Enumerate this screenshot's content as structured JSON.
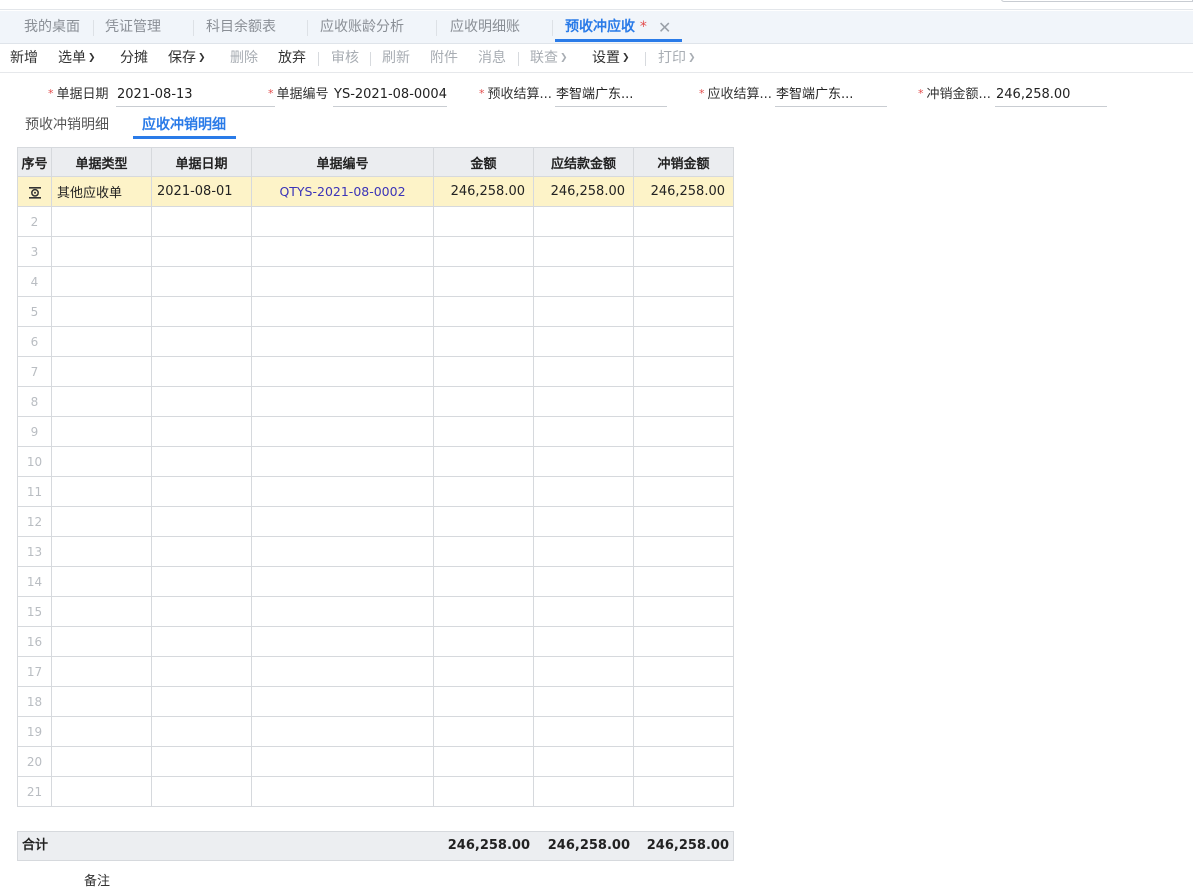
{
  "tabs": [
    {
      "label": "我的桌面"
    },
    {
      "label": "凭证管理"
    },
    {
      "label": "科目余额表"
    },
    {
      "label": "应收账龄分析"
    },
    {
      "label": "应收明细账"
    },
    {
      "label": "预收冲应收",
      "modified_mark": "*",
      "close": "✕"
    }
  ],
  "toolbar": {
    "add": "新增",
    "select": "选单",
    "allocate": "分摊",
    "save": "保存",
    "delete": "删除",
    "discard": "放弃",
    "audit": "审核",
    "refresh": "刷新",
    "attachment": "附件",
    "message": "消息",
    "linked_query": "联查",
    "settings": "设置",
    "print": "打印"
  },
  "form": {
    "doc_date_label": "单据日期",
    "doc_date_value": "2021-08-13",
    "doc_no_label": "单据编号",
    "doc_no_value": "YS-2021-08-0004",
    "prepay_settle_label": "预收结算...",
    "prepay_settle_value": "李智端广东...",
    "ar_settle_label": "应收结算...",
    "ar_settle_value": "李智端广东...",
    "writeoff_amount_label": "冲销金额...",
    "writeoff_amount_value": "246,258.00"
  },
  "subtabs": {
    "prepay_detail": "预收冲销明细",
    "ar_detail": "应收冲销明细"
  },
  "grid": {
    "columns": [
      "序号",
      "单据类型",
      "单据日期",
      "单据编号",
      "金额",
      "应结款金额",
      "冲销金额"
    ],
    "rows": [
      {
        "type": "其他应收单",
        "date": "2021-08-01",
        "doc_no": "QTYS-2021-08-0002",
        "amount": "246,258.00",
        "due": "246,258.00",
        "writeoff": "246,258.00"
      }
    ],
    "row_numbers": [
      "2",
      "3",
      "4",
      "5",
      "6",
      "7",
      "8",
      "9",
      "10",
      "11",
      "12",
      "13",
      "14",
      "15",
      "16",
      "17",
      "18",
      "19",
      "20",
      "21"
    ]
  },
  "totals": {
    "label": "合计",
    "amount": "246,258.00",
    "due": "246,258.00",
    "writeoff": "246,258.00"
  },
  "remark_label": "备注",
  "colors": {
    "accent": "#2a7be8",
    "active_row": "#fdf3c8",
    "link": "#3b34b8",
    "required": "#e34b4b"
  }
}
